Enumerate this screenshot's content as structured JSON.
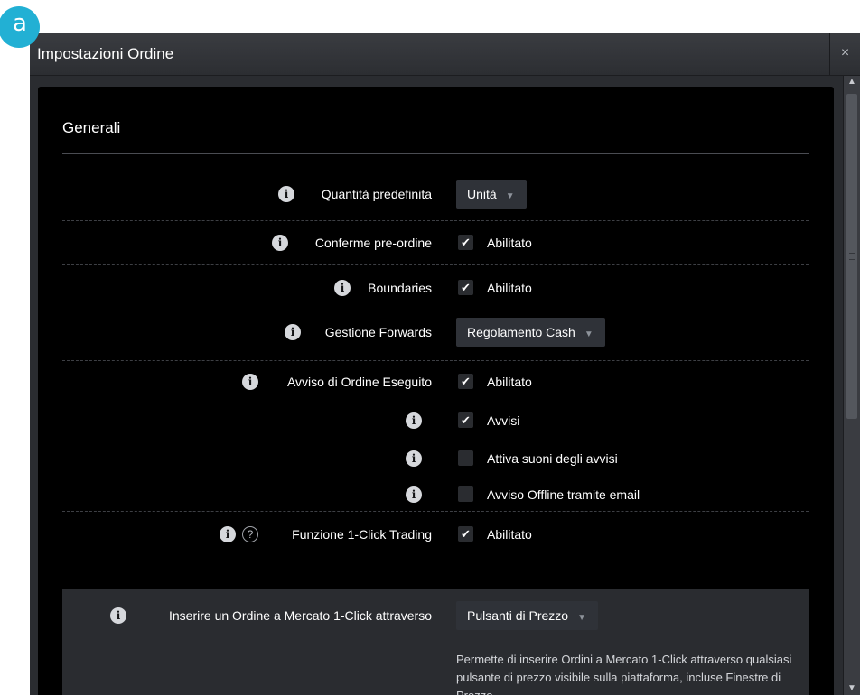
{
  "annotation": {
    "marker": "a"
  },
  "dialog": {
    "title": "Impostazioni Ordine",
    "close_icon": "×",
    "scrollbar": {
      "up_icon": "▲",
      "down_icon": "▼"
    }
  },
  "section": {
    "title": "Generali"
  },
  "rows": {
    "quantita": {
      "label": "Quantità predefinita",
      "info_icon": "i",
      "dropdown_value": "Unità",
      "caret": "▼"
    },
    "conferme": {
      "label": "Conferme pre-ordine",
      "info_icon": "i",
      "checked": true,
      "check_icon": "✔",
      "checkbox_label": "Abilitato"
    },
    "boundaries": {
      "label": "Boundaries",
      "info_icon": "i",
      "checked": true,
      "check_icon": "✔",
      "checkbox_label": "Abilitato"
    },
    "forwards": {
      "label": "Gestione Forwards",
      "info_icon": "i",
      "dropdown_value": "Regolamento Cash",
      "caret": "▼"
    },
    "avviso_eseguito": {
      "label": "Avviso di Ordine Eseguito",
      "info_icon": "i",
      "checked": true,
      "check_icon": "✔",
      "checkbox_label": "Abilitato"
    },
    "avvisi": {
      "info_icon": "i",
      "checked": true,
      "check_icon": "✔",
      "checkbox_label": "Avvisi"
    },
    "suoni": {
      "info_icon": "i",
      "checked": false,
      "checkbox_label": "Attiva suoni degli avvisi"
    },
    "offline": {
      "info_icon": "i",
      "checked": false,
      "checkbox_label": "Avviso Offline tramite email"
    },
    "one_click": {
      "label": "Funzione 1-Click Trading",
      "info_icon": "i",
      "help_icon": "?",
      "checked": true,
      "check_icon": "✔",
      "checkbox_label": "Abilitato"
    },
    "mercato": {
      "label": "Inserire un Ordine a Mercato 1-Click attraverso",
      "info_icon": "i",
      "dropdown_value": "Pulsanti di Prezzo",
      "caret": "▼",
      "description": "Permette di inserire Ordini a Mercato 1-Click attraverso qualsiasi pulsante di prezzo visibile sulla piattaforma, incluse Finestre di Prezzo."
    }
  },
  "colors": {
    "accent_marker": "#22b0d4",
    "panel_background": "#000000",
    "dialog_background": "#2a2c30",
    "control_background": "#2f3238"
  }
}
